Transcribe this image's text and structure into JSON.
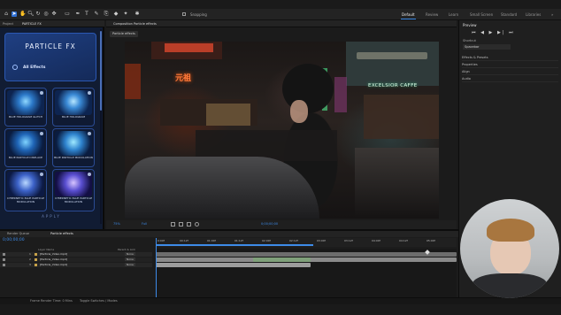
{
  "toolbar": {
    "snapping_label": "Snapping",
    "workspaces": [
      "Default",
      "Review",
      "Learn",
      "Small Screen",
      "Standard",
      "Libraries"
    ]
  },
  "left_panel": {
    "tabs": [
      "Project",
      "PARTICLE FX"
    ],
    "plugin_title": "PARTICLE FX",
    "all_effects_label": "All Effects",
    "cards": [
      {
        "label": "BLUE HOLOGRAM GLITCH"
      },
      {
        "label": "BLUE HOLOGRAM"
      },
      {
        "label": "BLUE PARTICLE DISPLACE"
      },
      {
        "label": "BLUE PARTICLE MODULATION"
      },
      {
        "label": "CYBERNETIC BLUE PARTICLE MODULATION"
      },
      {
        "label": "CYBERNETIC BLUE PARTICLE MODULATION"
      }
    ],
    "apply_label": "APPLY"
  },
  "composition": {
    "tab_label": "Composition Particle effects",
    "comp_chip": "Particle effects",
    "zoom": "75%",
    "quality": "Full",
    "timecode": "0;00;00;00",
    "sign_text": "元祖",
    "cafe_text": "EXCELSIOR CAFFE"
  },
  "right_panel": {
    "preview_label": "Preview",
    "shortcut_label": "Shortcut",
    "shortcut_value": "Spacebar",
    "sections": [
      "Effects & Presets",
      "Properties",
      "Align",
      "Audio"
    ]
  },
  "timeline": {
    "tabs": [
      "Render Queue",
      "Particle effects"
    ],
    "timecode": "0;00;00;00",
    "layer_header": "Layer Name",
    "parent_header": "Parent & Link",
    "layers": [
      {
        "num": "1",
        "name": "[Particle_Video.mp4]",
        "parent": "None"
      },
      {
        "num": "2",
        "name": "[Particle_Video.mp4]",
        "parent": "None"
      },
      {
        "num": "3",
        "name": "[Particle_Video.mp4]",
        "parent": "None"
      }
    ],
    "ruler_marks": [
      "0:00f",
      "00:12f",
      "01:00f",
      "01:12f",
      "02:00f",
      "02:12f",
      "03:00f",
      "03:12f",
      "04:00f",
      "04:12f",
      "05:00f"
    ]
  },
  "status_bar": {
    "render_time": "Frame Render Time: 0 Mins",
    "toggle": "Toggle Switches / Modes"
  },
  "colors": {
    "accent": "#2f6fd1",
    "plugin_bg": "#111c33",
    "layer_bar_green": "#7fa07a",
    "playhead": "#3d8be8"
  },
  "icons": [
    "home-icon",
    "selection-icon",
    "hand-icon",
    "zoom-icon",
    "rotate-icon",
    "camera-icon",
    "pan-icon",
    "rectangle-icon",
    "pen-icon",
    "type-icon",
    "brush-icon",
    "clone-icon",
    "eraser-icon",
    "roto-icon",
    "puppet-icon"
  ]
}
